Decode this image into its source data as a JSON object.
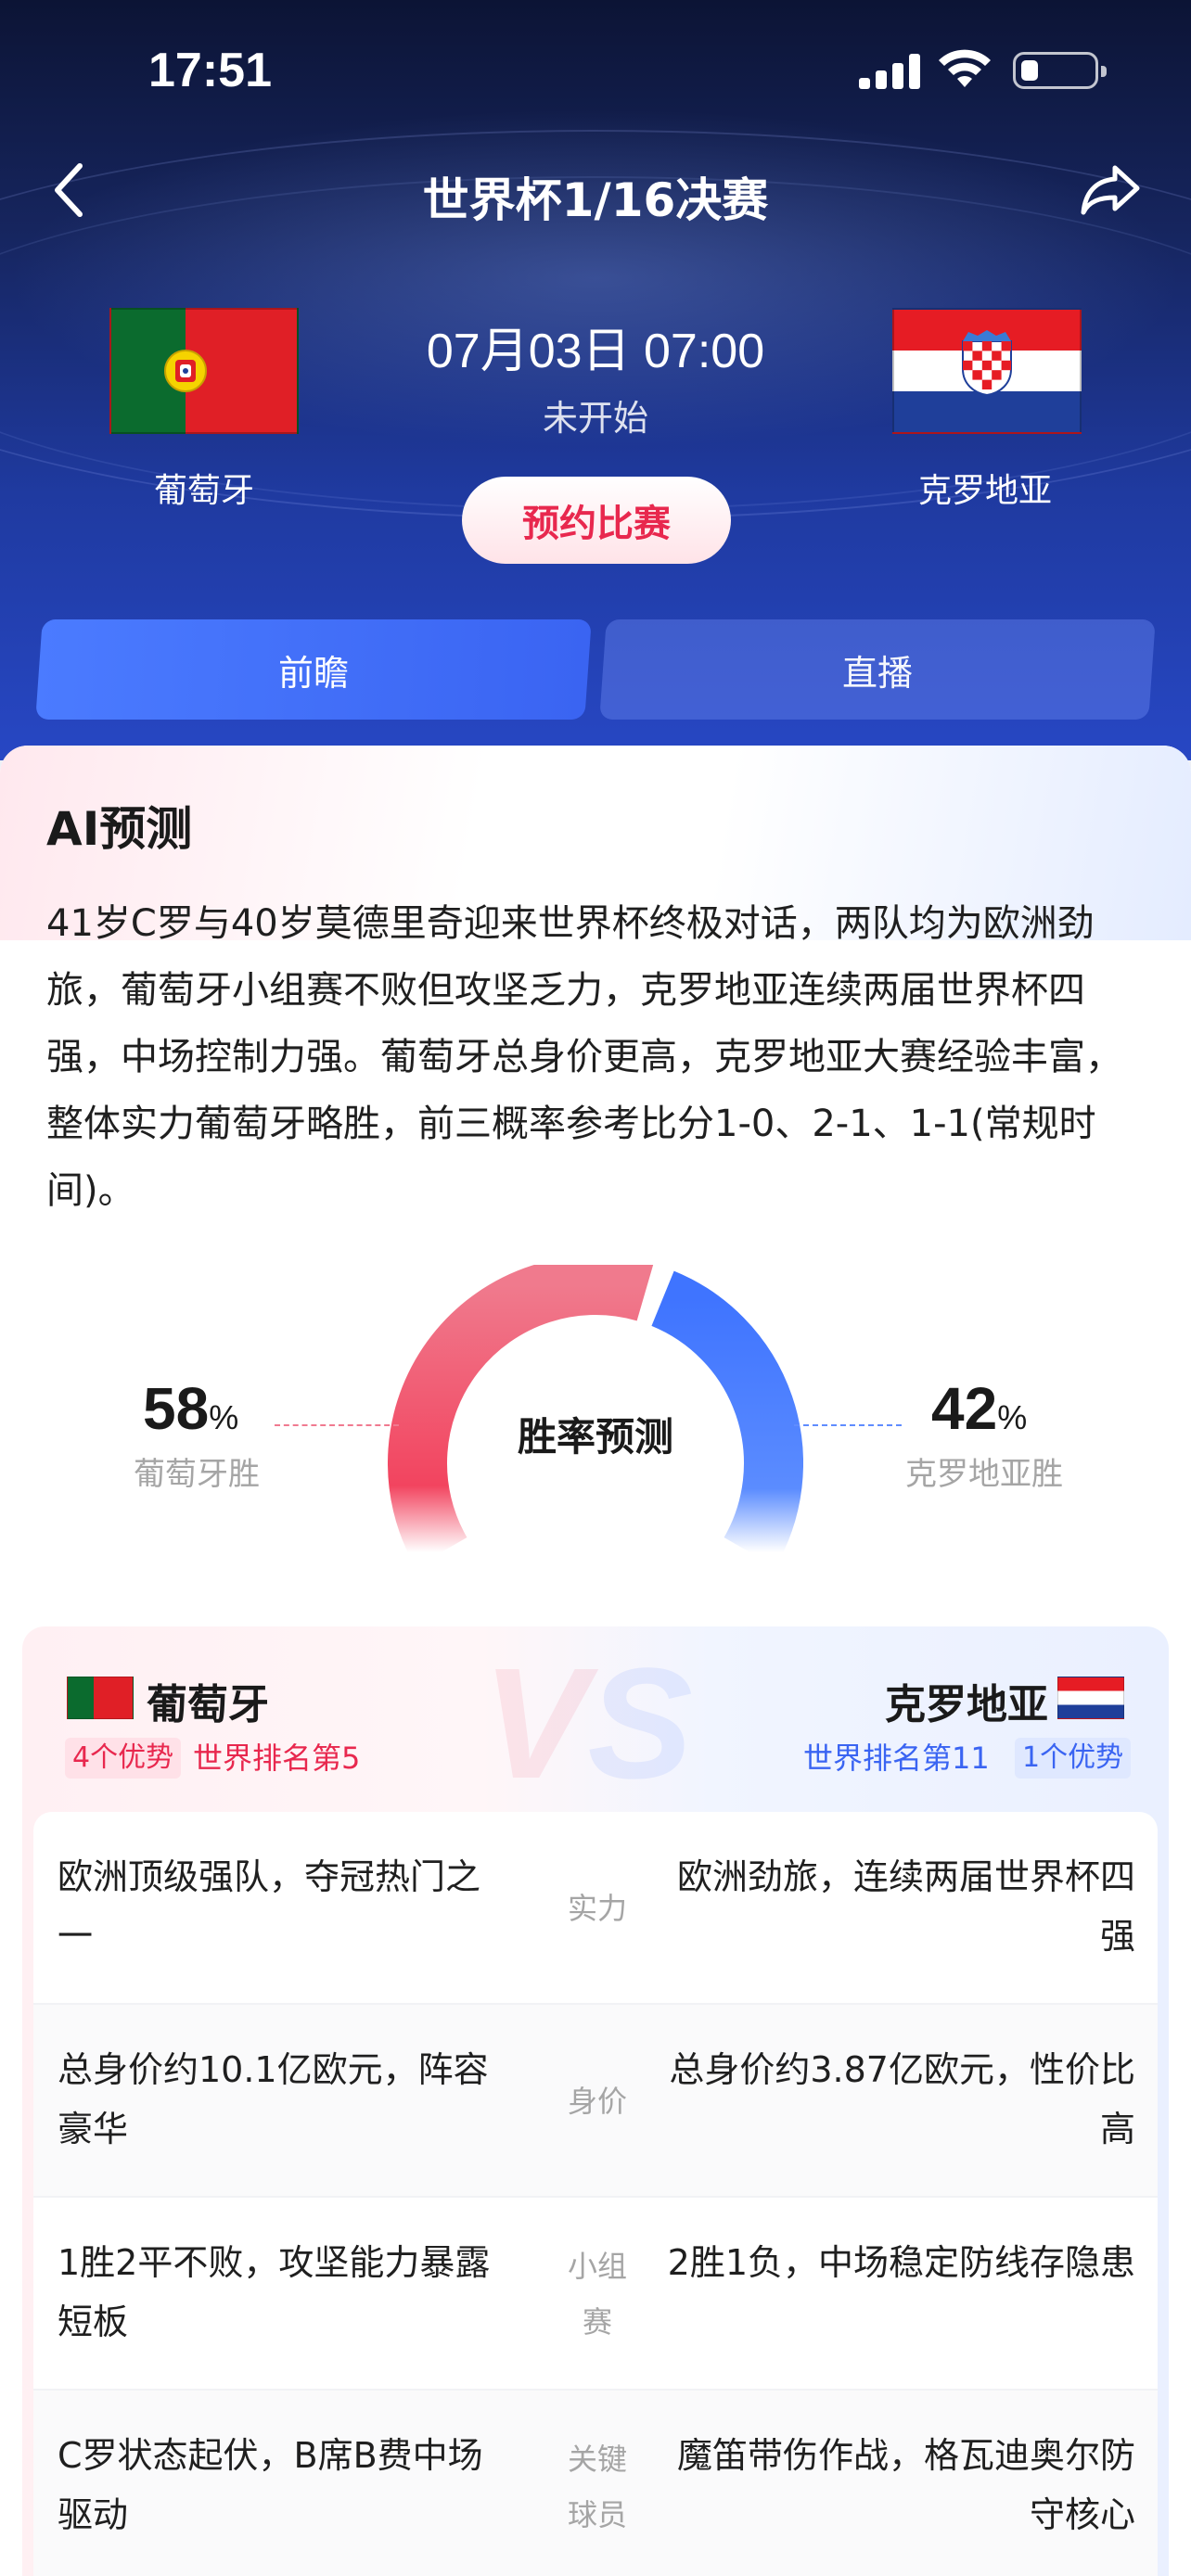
{
  "status_bar": {
    "time": "17:51"
  },
  "nav": {
    "title": "世界杯1/16决赛"
  },
  "match": {
    "home_team": "葡萄牙",
    "away_team": "克罗地亚",
    "datetime": "07月03日 07:00",
    "status": "未开始",
    "reserve_label": "预约比赛"
  },
  "tabs": [
    {
      "label": "前瞻",
      "active": true
    },
    {
      "label": "直播",
      "active": false
    }
  ],
  "ai": {
    "title": "AI预测",
    "text": "41岁C罗与40岁莫德里奇迎来世界杯终极对话，两队均为欧洲劲旅，葡萄牙小组赛不败但攻坚乏力，克罗地亚连续两届世界杯四强，中场控制力强。葡萄牙总身价更高，克罗地亚大赛经验丰富，整体实力葡萄牙略胜，前三概率参考比分1-0、2-1、1-1(常规时间)。"
  },
  "prediction": {
    "center_label": "胜率预测",
    "home_pct": "58",
    "away_pct": "42",
    "pct_unit": "%",
    "home_label": "葡萄牙胜",
    "away_label": "克罗地亚胜",
    "home_color": "#f2445f",
    "away_color": "#3f74ff"
  },
  "compare": {
    "home_team": "葡萄牙",
    "away_team": "克罗地亚",
    "home_adv": "4个优势",
    "away_adv": "1个优势",
    "home_rank": "世界排名第5",
    "away_rank": "世界排名第11",
    "rows": [
      {
        "left": "欧洲顶级强队，夺冠热门之一",
        "label": "实力",
        "right": "欧洲劲旅，连续两届世界杯四强"
      },
      {
        "left": "总身价约10.1亿欧元，阵容豪华",
        "label": "身价",
        "right": "总身价约3.87亿欧元，性价比高"
      },
      {
        "left": "1胜2平不败，攻坚能力暴露短板",
        "label": "小组赛",
        "right": "2胜1负，中场稳定防线存隐患"
      },
      {
        "left": "C罗状态起伏，B席B费中场驱动",
        "label": "关键球员",
        "right": "魔笛带伤作战，格瓦迪奥尔防守核心"
      }
    ]
  }
}
